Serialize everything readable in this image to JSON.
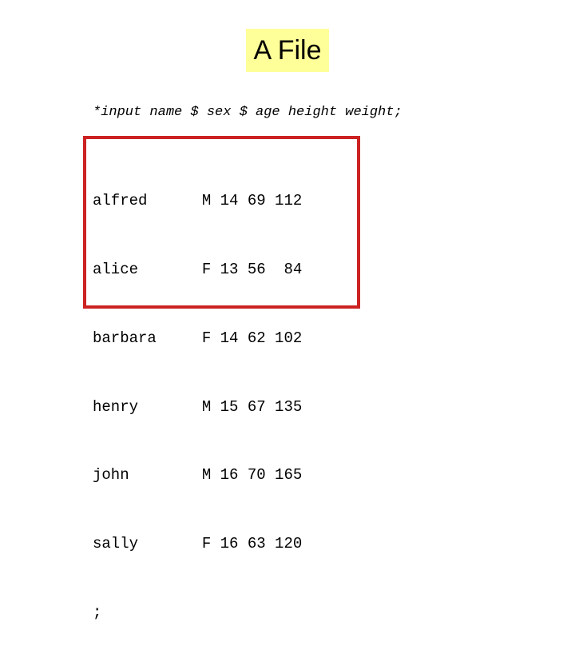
{
  "colors": {
    "page_background": "#FFFFFF",
    "title_highlight": "#FFFF99",
    "title_text": "#000000",
    "box_border": "#CC2222",
    "body_text": "#000000"
  },
  "slide": {
    "title": "A File",
    "input_statement": "*input name $ sex $ age height weight;",
    "data_block": {
      "columns": [
        "name",
        "sex",
        "age",
        "height",
        "weight"
      ],
      "rows": [
        {
          "name": "alfred",
          "sex": "M",
          "age": "14",
          "height": "69",
          "weight": "112"
        },
        {
          "name": "alice",
          "sex": "F",
          "age": "13",
          "height": "56",
          "weight": "84"
        },
        {
          "name": "barbara",
          "sex": "F",
          "age": "14",
          "height": "62",
          "weight": "102"
        },
        {
          "name": "henry",
          "sex": "M",
          "age": "15",
          "height": "67",
          "weight": "135"
        },
        {
          "name": "john",
          "sex": "M",
          "age": "16",
          "height": "70",
          "weight": "165"
        },
        {
          "name": "sally",
          "sex": "F",
          "age": "16",
          "height": "63",
          "weight": "120"
        }
      ],
      "terminator": ";",
      "lines": [
        "alfred      M 14 69 112",
        "alice       F 13 56  84",
        "barbara     F 14 62 102",
        "henry       M 15 67 135",
        "john        M 16 70 165",
        "sally       F 16 63 120",
        ";"
      ]
    }
  }
}
